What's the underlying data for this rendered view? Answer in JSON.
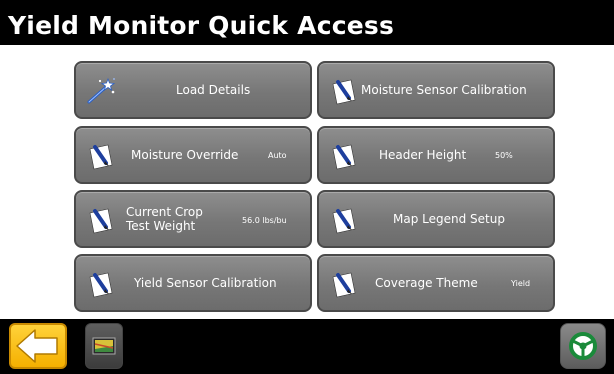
{
  "header": {
    "title": "Yield Monitor Quick Access"
  },
  "tiles": [
    {
      "label": "Load Details",
      "value": "",
      "icon": "wand-icon"
    },
    {
      "label": "Moisture Sensor Calibration",
      "value": "",
      "icon": "pencil-paper-icon"
    },
    {
      "label": "Moisture Override",
      "value": "Auto",
      "icon": "pencil-paper-icon"
    },
    {
      "label": "Header Height",
      "value": "50%",
      "icon": "pencil-paper-icon"
    },
    {
      "label_line1": "Current Crop",
      "label_line2": "Test Weight",
      "value": "56.0 lbs/bu",
      "icon": "pencil-paper-icon"
    },
    {
      "label": "Map Legend Setup",
      "value": "",
      "icon": "pencil-paper-icon"
    },
    {
      "label": "Yield Sensor Calibration",
      "value": "",
      "icon": "pencil-paper-icon"
    },
    {
      "label": "Coverage Theme",
      "value": "Yield",
      "icon": "pencil-paper-icon"
    }
  ],
  "bottom_bar": {
    "back_icon": "back-arrow-icon",
    "map_icon": "map-view-icon",
    "steer_icon": "steering-wheel-icon"
  },
  "colors": {
    "title_bg": "#000000",
    "tile_bg": "#7a7a7a",
    "back_button": "#f5b000",
    "steering_green": "#22b14c"
  }
}
